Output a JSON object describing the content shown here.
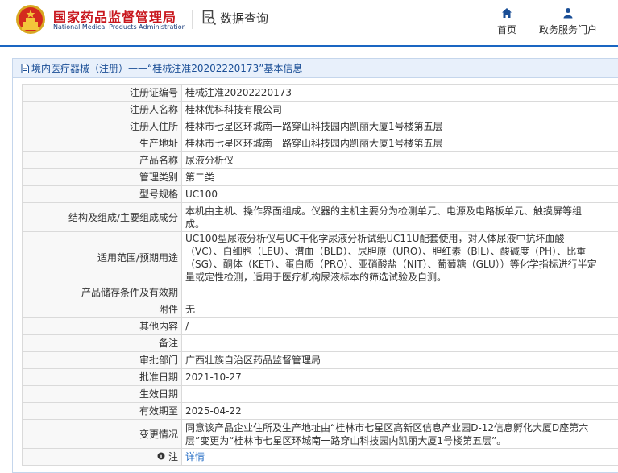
{
  "header": {
    "brand_cn": "国家药品监督管理局",
    "brand_en": "National Medical Products Administration",
    "query_label": "数据查询",
    "nav": [
      {
        "label": "首页",
        "icon": "home-icon"
      },
      {
        "label": "政务服务门户",
        "icon": "user-icon"
      }
    ],
    "accent_color": "#1a66c2",
    "brand_color": "#c8161d"
  },
  "panel": {
    "title": "境内医疗器械（注册）——“桂械注准20202220173”基本信息"
  },
  "rows": [
    {
      "label": "注册证编号",
      "value": "桂械注准20202220173"
    },
    {
      "label": "注册人名称",
      "value": "桂林优科科技有限公司"
    },
    {
      "label": "注册人住所",
      "value": "桂林市七星区环城南一路穿山科技园内凯丽大厦1号楼第五层"
    },
    {
      "label": "生产地址",
      "value": "桂林市七星区环城南一路穿山科技园内凯丽大厦1号楼第五层"
    },
    {
      "label": "产品名称",
      "value": "尿液分析仪"
    },
    {
      "label": "管理类别",
      "value": "第二类"
    },
    {
      "label": "型号规格",
      "value": "UC100"
    },
    {
      "label": "结构及组成/主要组成成分",
      "value": "本机由主机、操作界面组成。仪器的主机主要分为检测单元、电源及电路板单元、触摸屏等组成。"
    },
    {
      "label": "适用范围/预期用途",
      "value": "UC100型尿液分析仪与UC干化学尿液分析试纸UC11U配套使用，对人体尿液中抗坏血酸（VC）、白细胞（LEU）、潜血（BLD）、尿胆原（URO）、胆红素（BIL）、酸碱度（PH）、比重（SG）、酮体（KET）、蛋白质（PRO）、亚硝酸盐（NIT）、葡萄糖（GLU））等化学指标进行半定量或定性检测，适用于医疗机构尿液标本的筛选试验及自测。"
    },
    {
      "label": "产品储存条件及有效期",
      "value": ""
    },
    {
      "label": "附件",
      "value": "无"
    },
    {
      "label": "其他内容",
      "value": "/"
    },
    {
      "label": "备注",
      "value": ""
    },
    {
      "label": "审批部门",
      "value": "广西壮族自治区药品监督管理局"
    },
    {
      "label": "批准日期",
      "value": "2021-10-27"
    },
    {
      "label": "生效日期",
      "value": ""
    },
    {
      "label": "有效期至",
      "value": "2025-04-22"
    },
    {
      "label": "变更情况",
      "value": "同意该产品企业住所及生产地址由“桂林市七星区高新区信息产业园D-12信息孵化大厦D座第六层”变更为“桂林市七星区环城南一路穿山科技园内凯丽大厦1号楼第五层”。"
    },
    {
      "label": "注",
      "value": "详情",
      "icon": "info-icon"
    }
  ]
}
